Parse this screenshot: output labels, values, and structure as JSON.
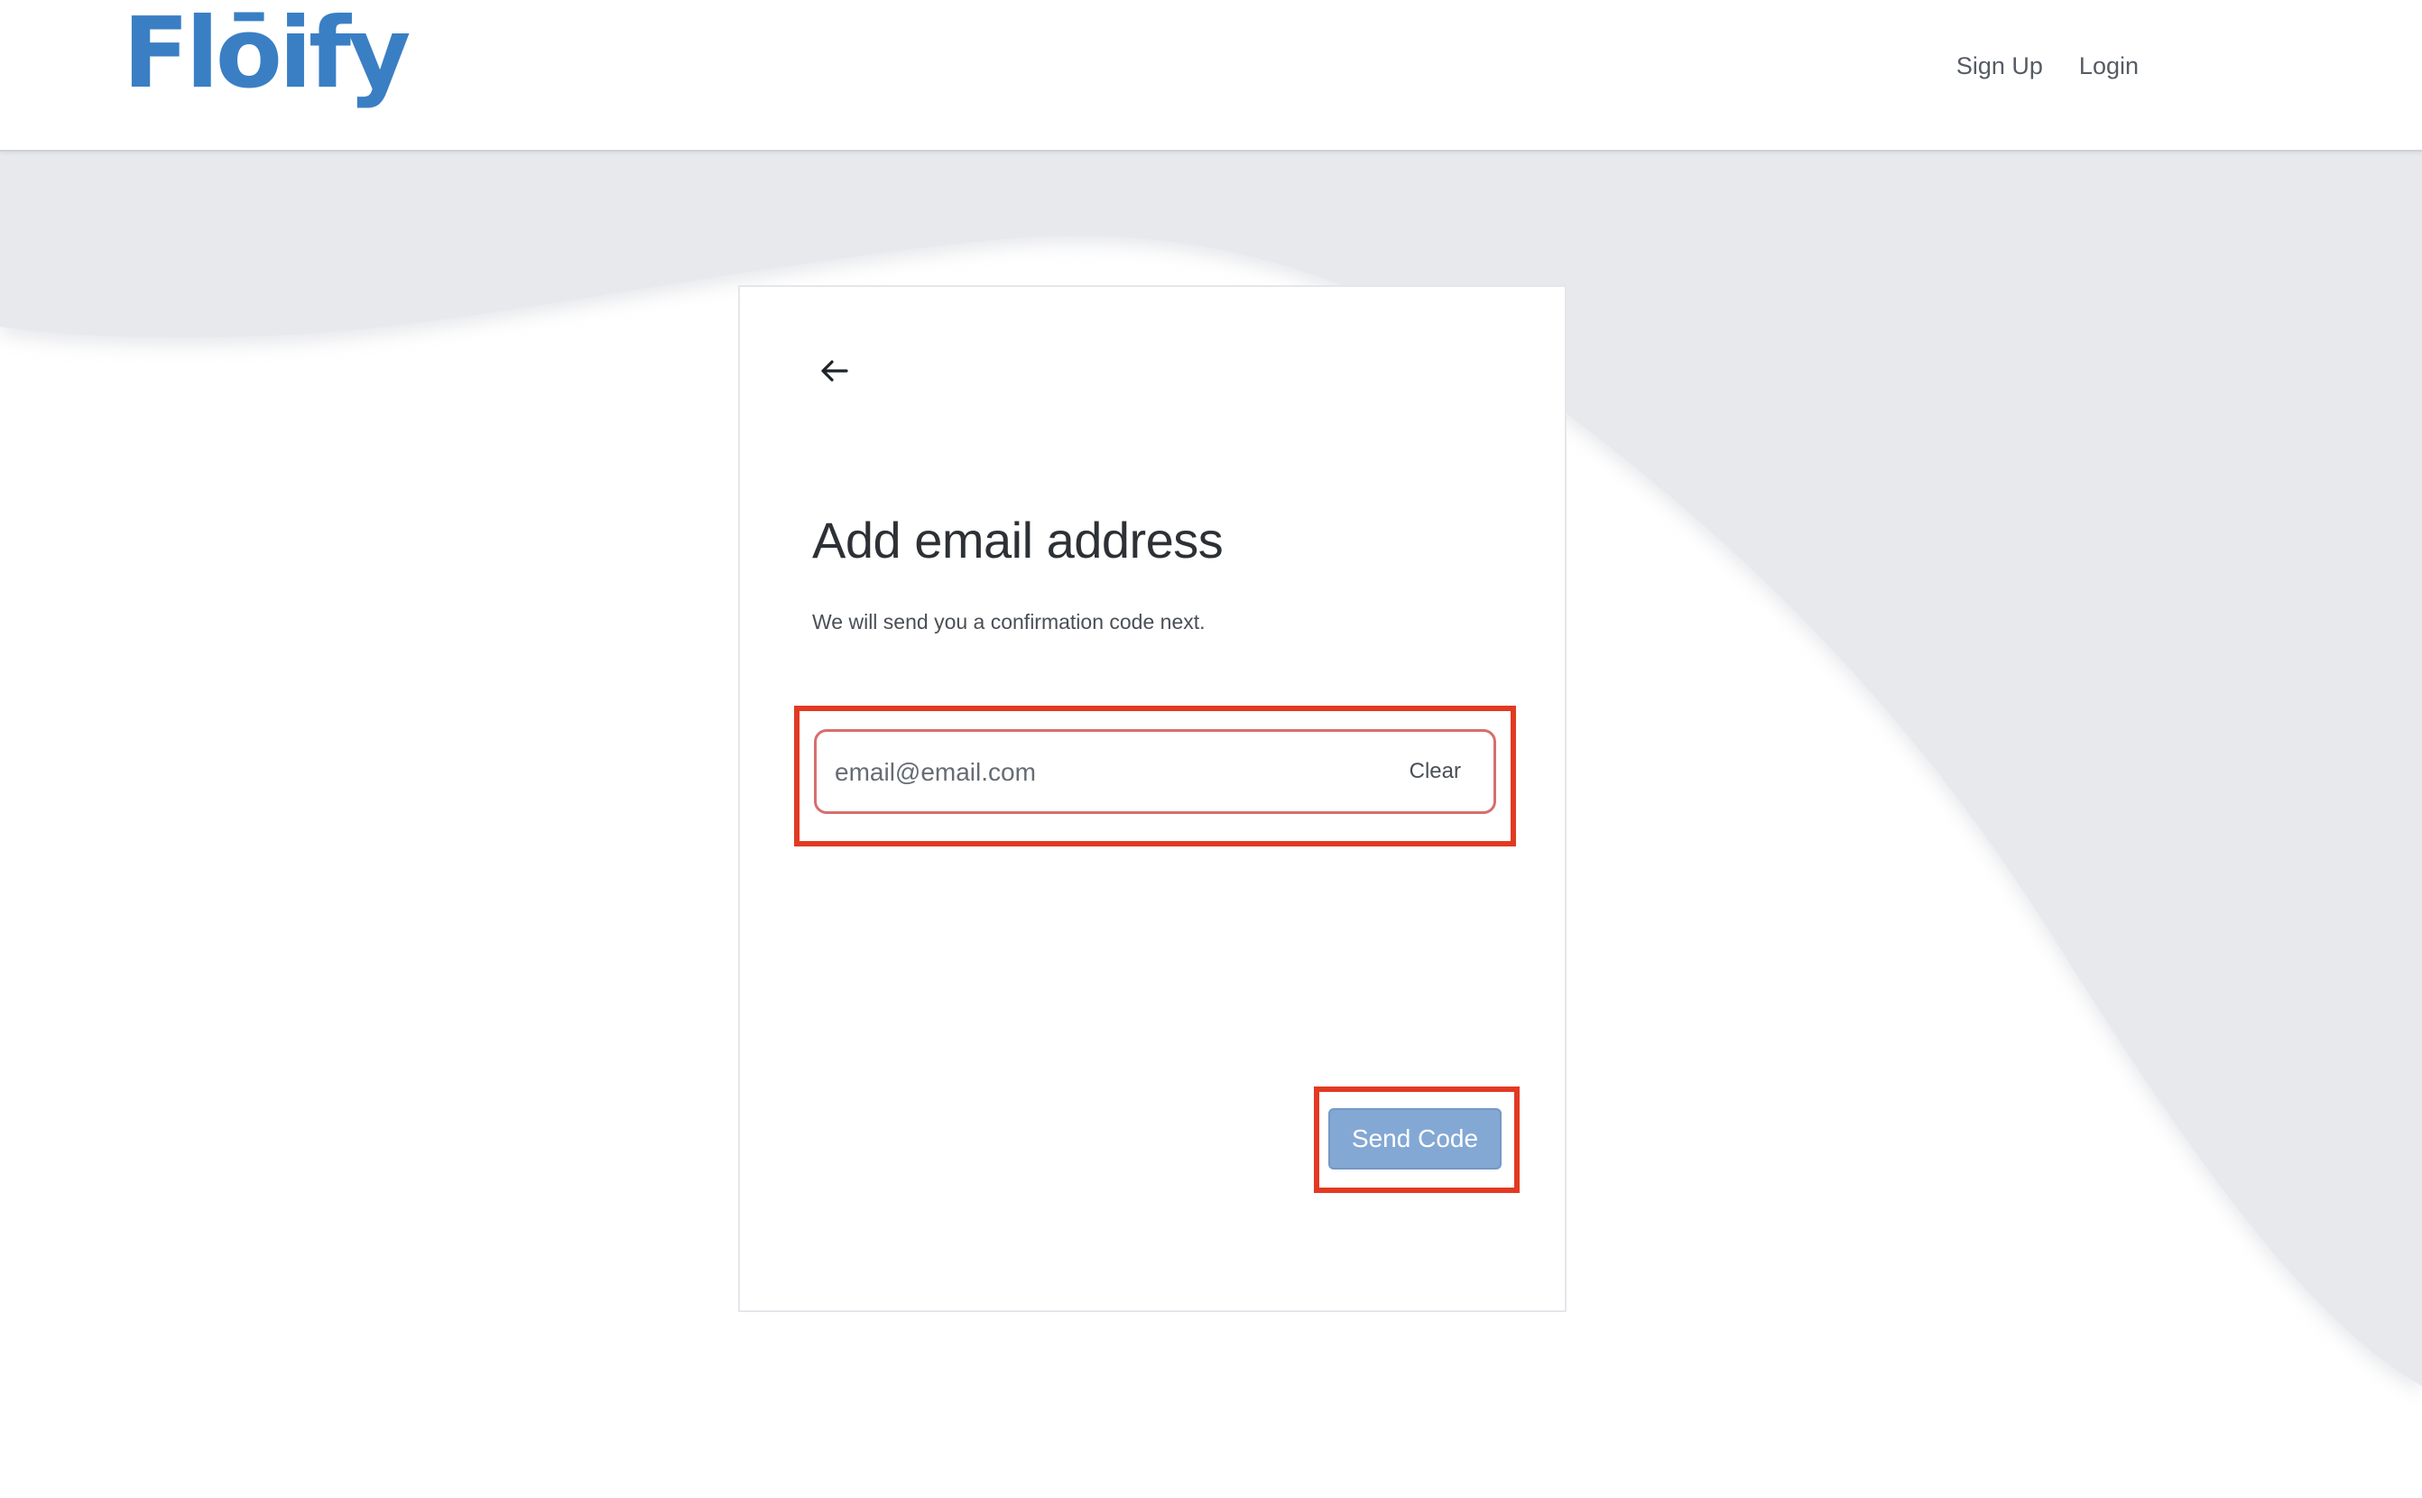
{
  "header": {
    "logo_text": "Flōify",
    "nav": {
      "signup_label": "Sign Up",
      "login_label": "Login"
    }
  },
  "form": {
    "title": "Add email address",
    "subtitle": "We will send you a confirmation code next.",
    "email": {
      "value": "",
      "placeholder": "email@email.com"
    },
    "clear_label": "Clear",
    "send_label": "Send Code"
  },
  "colors": {
    "brand": "#3a7fc4",
    "button": "#84a8d4",
    "highlight": "#e23a22",
    "background_wave": "#e8e9ed"
  }
}
